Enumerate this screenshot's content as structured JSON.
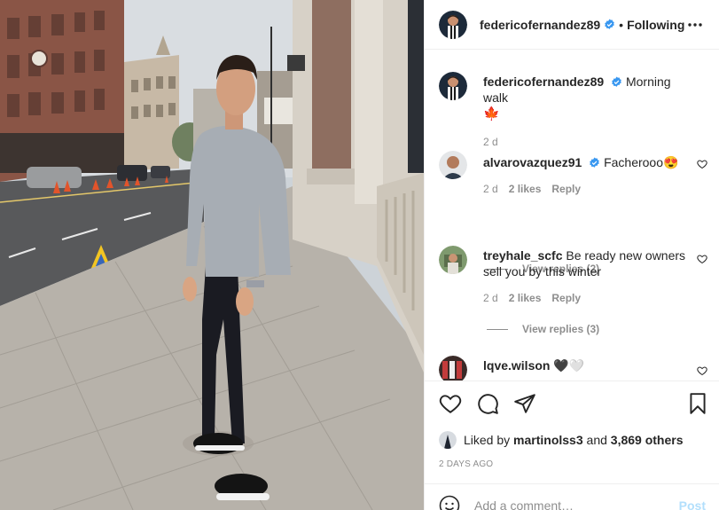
{
  "post": {
    "author": "federicofernandez89",
    "separator": "•",
    "follow_label": "Following",
    "caption": "Morning walk",
    "caption_emoji": "🍁",
    "age": "2 d"
  },
  "comments": [
    {
      "user": "alvarovazquez91",
      "verified": true,
      "text": "Facherooo",
      "emoji": "😍",
      "age": "2 d",
      "likes": "2 likes",
      "reply_label": "Reply",
      "view_replies": "View replies (2)"
    },
    {
      "user": "treyhale_scfc",
      "verified": false,
      "text": "Be ready new owners sell you by this winter",
      "emoji": "",
      "age": "2 d",
      "likes": "2 likes",
      "reply_label": "Reply",
      "view_replies": "View replies (3)"
    },
    {
      "user": "lqve.wilson",
      "verified": false,
      "text": "🖤🤍",
      "emoji": "",
      "age": "",
      "likes": "",
      "reply_label": "",
      "view_replies": ""
    }
  ],
  "likes": {
    "prefix": "Liked by",
    "user": "martinolss3",
    "middle": "and",
    "count": "3,869 others"
  },
  "timestamp": "2 DAYS AGO",
  "add_comment": {
    "placeholder": "Add a comment…",
    "post_label": "Post"
  },
  "icons": {
    "verified": "verified-badge-icon",
    "more": "more-options-icon",
    "like": "heart-icon",
    "comment": "comment-icon",
    "share": "paper-plane-icon",
    "save": "bookmark-icon",
    "emoji": "smiley-icon"
  },
  "colors": {
    "verified": "#3897f0",
    "muted": "#8e8e8e",
    "text": "#262626",
    "post_disabled": "#b2dffc"
  }
}
